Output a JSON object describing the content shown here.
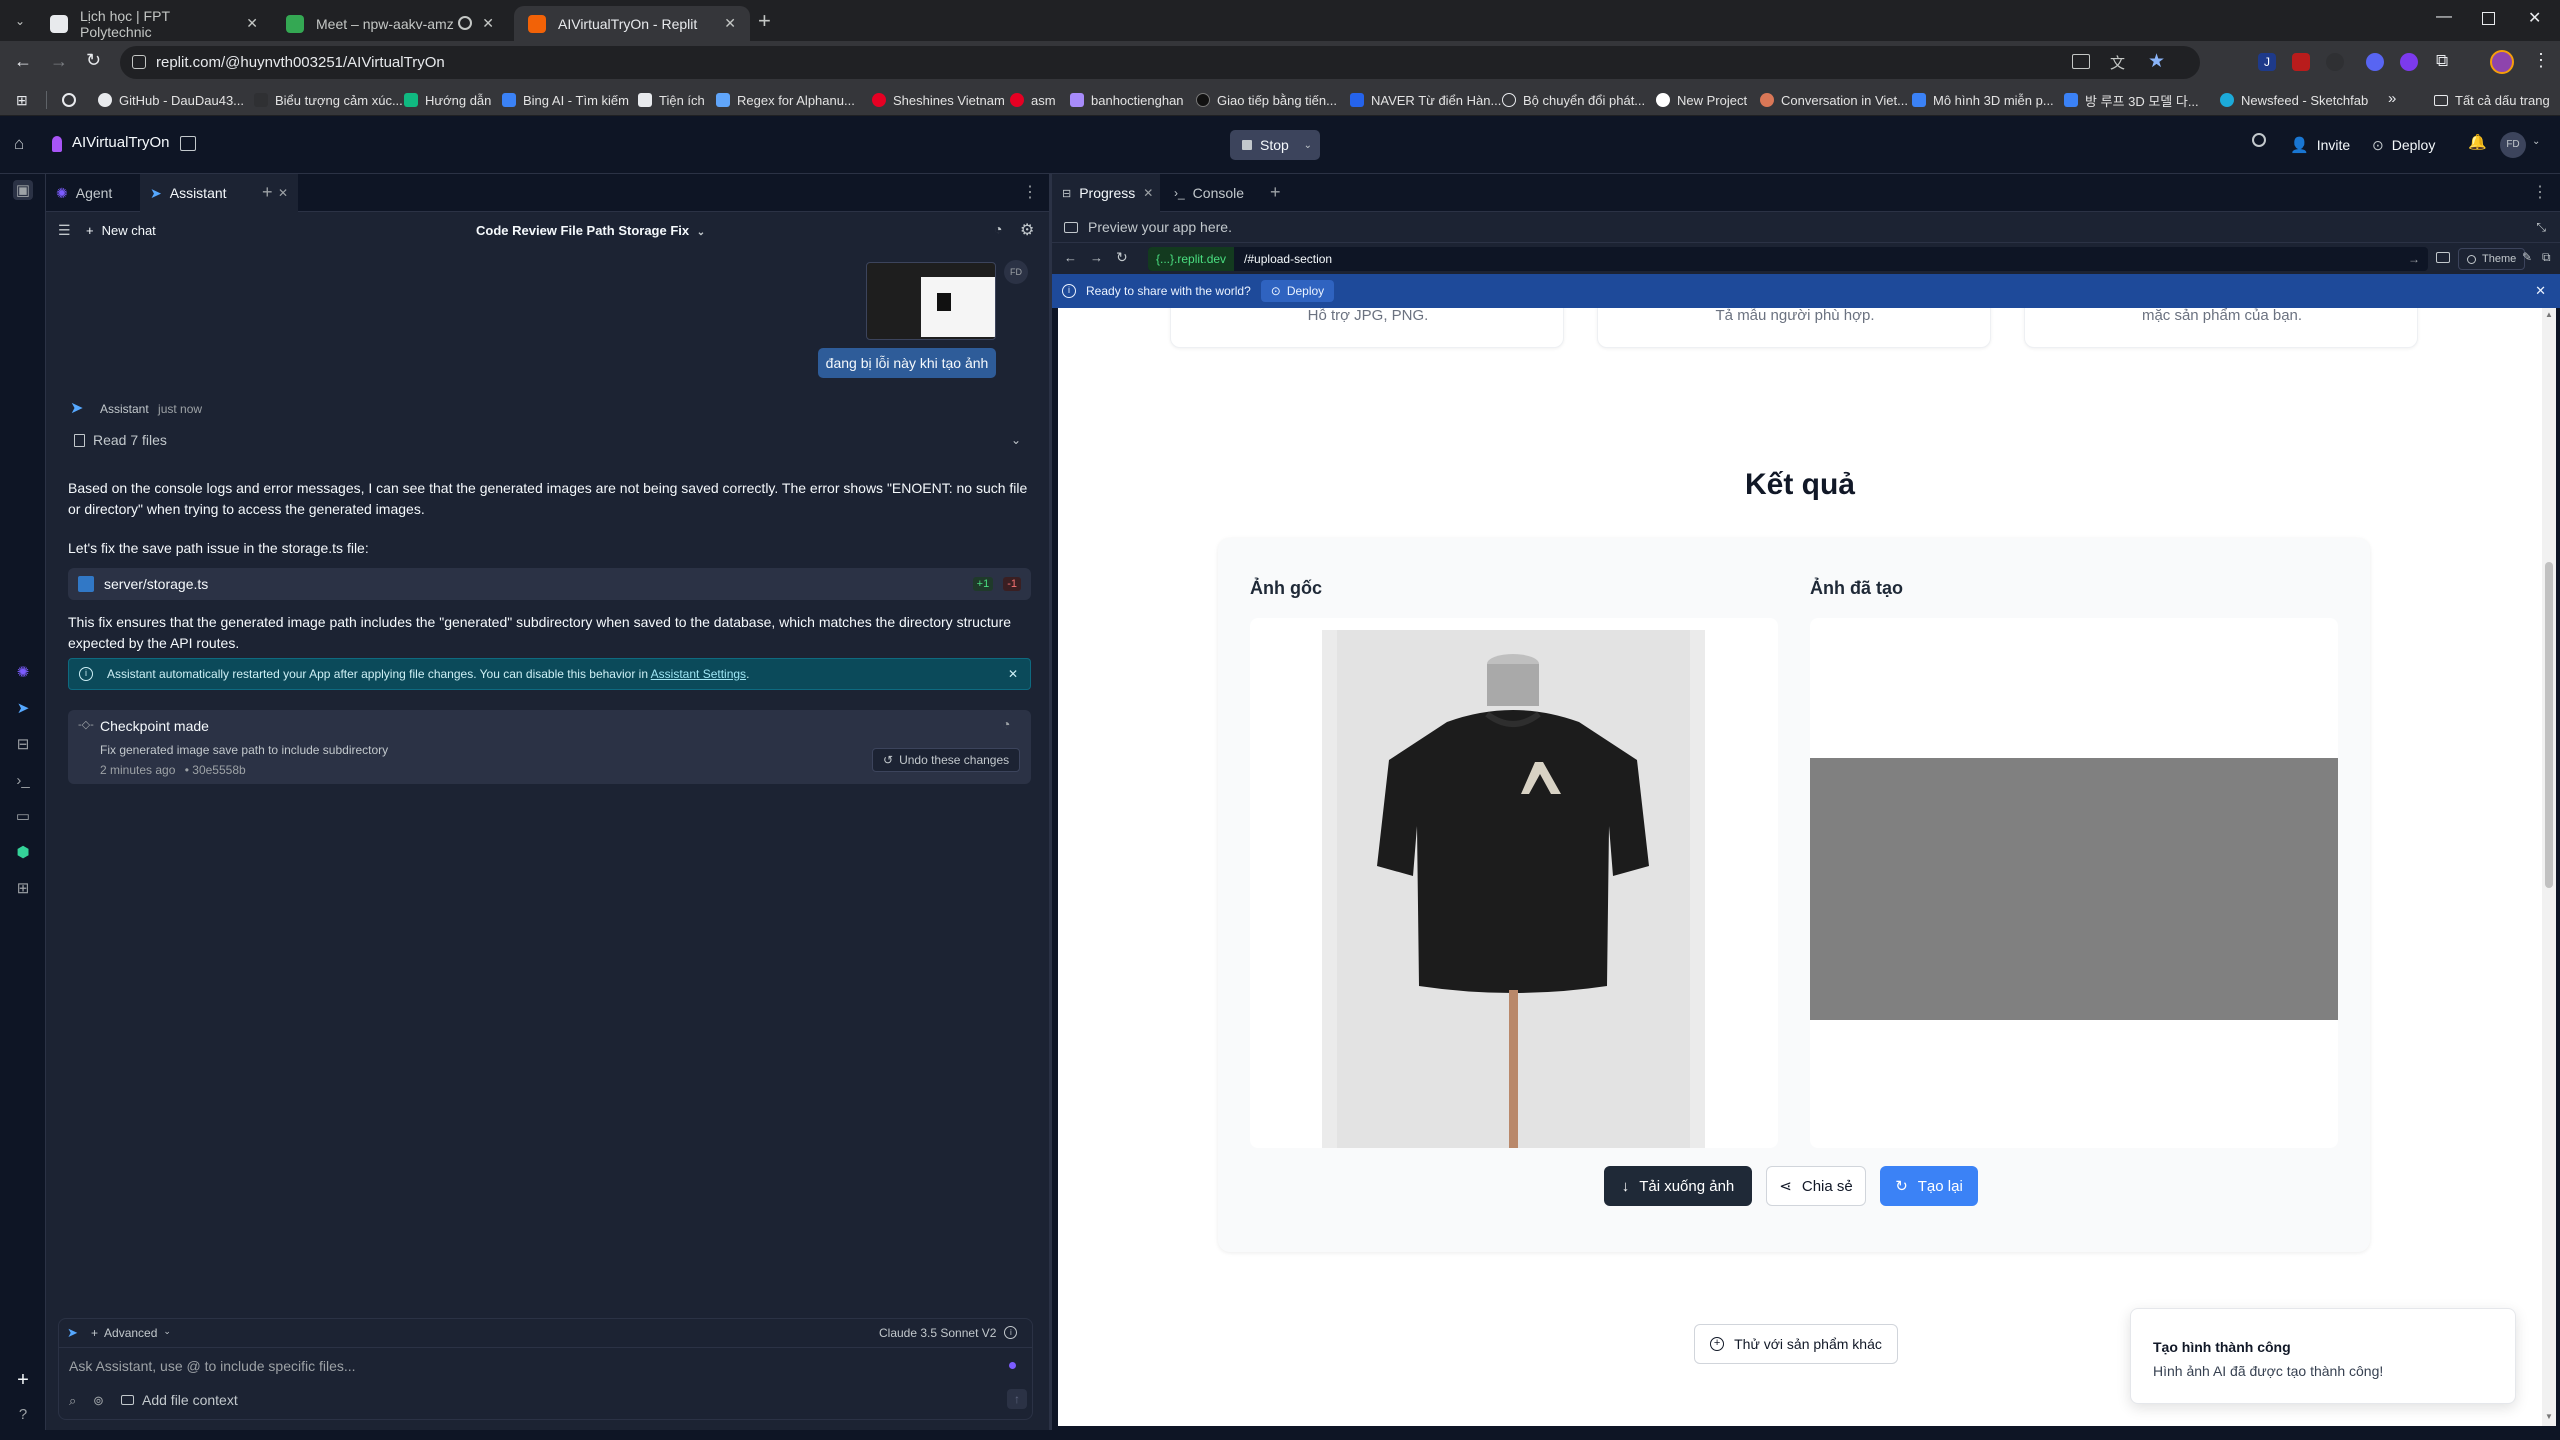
{
  "browser": {
    "tabs": [
      {
        "title": "Lịch học | FPT Polytechnic",
        "favicon_color": "#e8eaed"
      },
      {
        "title": "Meet – npw-aakv-amz",
        "favicon_color": "#34a853"
      },
      {
        "title": "AIVirtualTryOn - Replit",
        "favicon_color": "#f26207"
      }
    ],
    "url": "replit.com/@huynvth003251/AIVirtualTryOn",
    "bookmarks": [
      {
        "label": "GitHub - DauDau43...",
        "color": "#e8eaed"
      },
      {
        "label": "Biểu tượng cảm xúc...",
        "color": "#2f3033"
      },
      {
        "label": "Hướng dẫn",
        "color": "#10b981"
      },
      {
        "label": "Bing AI - Tìm kiếm",
        "color": "#3b82f6"
      },
      {
        "label": "Tiện ích",
        "color": "#e8eaed"
      },
      {
        "label": "Regex for Alphanu...",
        "color": "#60a5fa"
      },
      {
        "label": "Sheshines Vietnam",
        "color": "#e60023"
      },
      {
        "label": "asm",
        "color": "#e60023"
      },
      {
        "label": "banhoctienghan",
        "color": "#a78bfa"
      },
      {
        "label": "Giao tiếp bằng tiến...",
        "color": "#111111"
      },
      {
        "label": "NAVER Từ điển Hàn...",
        "color": "#2563eb"
      },
      {
        "label": "Bộ chuyển đổi phát...",
        "color": "#e8eaed"
      },
      {
        "label": "New Project",
        "color": "#ffffff"
      },
      {
        "label": "Conversation in Viet...",
        "color": "#d97757"
      },
      {
        "label": "Mô hình 3D miễn p...",
        "color": "#3b82f6"
      },
      {
        "label": "방 루프 3D 모델 다...",
        "color": "#3b82f6"
      },
      {
        "label": "Newsfeed - Sketchfab",
        "color": "#1caad9"
      }
    ],
    "all_bookmarks": "Tất cả dấu trang"
  },
  "replit": {
    "project_name": "AIVirtualTryOn",
    "stop_label": "Stop",
    "invite_label": "Invite",
    "deploy_label": "Deploy",
    "avatar_initials": "FD"
  },
  "left_pane": {
    "tabs": [
      {
        "label": "Agent"
      },
      {
        "label": "Assistant"
      }
    ],
    "new_chat": "New chat",
    "chat_title": "Code Review File Path Storage Fix",
    "user_message": "đang bị lỗi này khi tạo ảnh",
    "assistant_name": "Assistant",
    "assistant_time": "just now",
    "read_files": "Read 7 files",
    "para1": "Based on the console logs and error messages, I can see that the generated images are not being saved correctly. The error shows \"ENOENT: no such file or directory\" when trying to access the generated images.",
    "para2": "Let's fix the save path issue in the storage.ts file:",
    "file_name": "server/storage.ts",
    "file_added": "+1",
    "file_removed": "-1",
    "para3": "This fix ensures that the generated image path includes the \"generated\" subdirectory when saved to the database, which matches the directory structure expected by the API routes.",
    "banner_text": "Assistant automatically restarted your App after applying file changes. You can disable this behavior in",
    "banner_link": "Assistant Settings",
    "checkpoint_title": "Checkpoint made",
    "checkpoint_desc": "Fix generated image save path to include subdirectory",
    "checkpoint_time": "2 minutes ago",
    "checkpoint_hash": "• 30e5558b",
    "undo_label": "Undo these changes",
    "composer": {
      "mode": "Advanced",
      "model": "Claude 3.5 Sonnet V2",
      "placeholder": "Ask Assistant, use @ to include specific files...",
      "add_file": "Add file context"
    }
  },
  "right_pane": {
    "tabs": [
      {
        "label": "Progress"
      },
      {
        "label": "Console"
      }
    ],
    "preview_text": "Preview your app here.",
    "domain": "{...}.replit.dev",
    "path": "/#upload-section",
    "theme_label": "Theme",
    "share_banner": "Ready to share with the world?",
    "share_deploy": "Deploy"
  },
  "app": {
    "top_card_texts": [
      "Hỗ trợ JPG, PNG.",
      "Tả mẫu người phù hợp.",
      "mặc sản phẩm của bạn."
    ],
    "result_title": "Kết quả",
    "original_label": "Ảnh gốc",
    "generated_label": "Ảnh đã tạo",
    "download_label": "Tải xuống ảnh",
    "share_label": "Chia sẻ",
    "regenerate_label": "Tạo lại",
    "try_other_label": "Thử với sản phẩm khác",
    "toast_title": "Tạo hình thành công",
    "toast_desc": "Hình ảnh AI đã được tạo thành công!",
    "accent_color": "#3b82f6"
  }
}
